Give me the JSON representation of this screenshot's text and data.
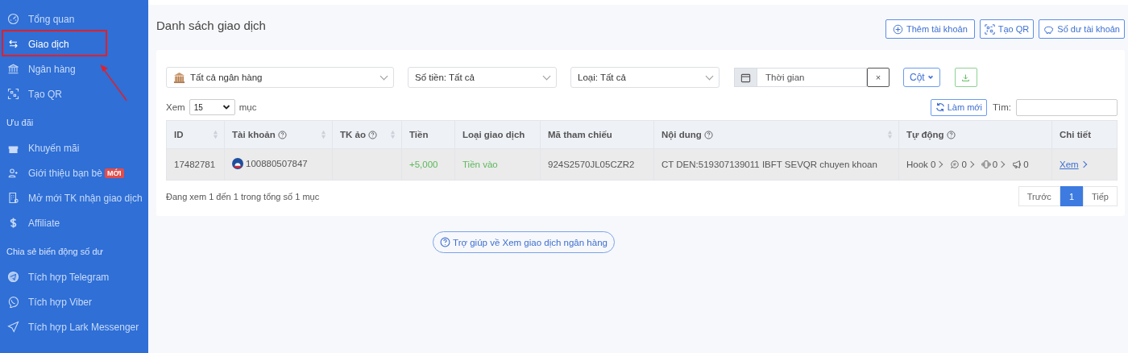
{
  "sidebar": {
    "groups": [
      {
        "items": [
          {
            "label": "Tổng quan",
            "selected": false
          },
          {
            "label": "Giao dịch",
            "selected": true
          },
          {
            "label": "Ngân hàng",
            "selected": false
          },
          {
            "label": "Tạo QR",
            "selected": false
          }
        ]
      },
      {
        "heading": "Ưu đãi",
        "items": [
          {
            "label": "Khuyến mãi",
            "selected": false
          },
          {
            "label": "Giới thiệu bạn bè",
            "badge": "MỚI",
            "selected": false
          },
          {
            "label": "Mở mới TK nhận giao dịch",
            "selected": false
          },
          {
            "label": "Affiliate",
            "selected": false
          }
        ]
      },
      {
        "heading": "Chia sẻ biến động số dư",
        "items": [
          {
            "label": "Tích hợp Telegram",
            "selected": false
          },
          {
            "label": "Tích hợp Viber",
            "selected": false
          },
          {
            "label": "Tích hợp Lark Messenger",
            "selected": false
          }
        ]
      }
    ]
  },
  "page": {
    "title": "Danh sách giao dịch",
    "actions": [
      "Thêm tài khoản",
      "Tạo QR",
      "Số dư tài khoản"
    ]
  },
  "filters": {
    "bank": "Tất cả ngân hàng",
    "amount": "Số tiền: Tất cả",
    "type": "Loại: Tất cả",
    "date_placeholder": "Thời gian",
    "clear": "×",
    "columns_button": "Cột"
  },
  "length": {
    "before": "Xem",
    "value": "15",
    "after": "mục"
  },
  "refresh": "Làm mới",
  "search_label": "Tìm:",
  "table": {
    "columns": [
      {
        "label": "ID",
        "help": false,
        "sortable": true
      },
      {
        "label": "Tài khoản",
        "help": true,
        "sortable": true
      },
      {
        "label": "TK ảo",
        "help": true,
        "sortable": true
      },
      {
        "label": "Tiền",
        "help": false,
        "sortable": false
      },
      {
        "label": "Loại giao dịch",
        "help": false,
        "sortable": false
      },
      {
        "label": "Mã tham chiếu",
        "help": false,
        "sortable": false
      },
      {
        "label": "Nội dung",
        "help": true,
        "sortable": true
      },
      {
        "label": "Tự động",
        "help": true,
        "sortable": false
      },
      {
        "label": "Chi tiết",
        "help": false,
        "sortable": false
      }
    ],
    "rows": [
      {
        "id": "17482781",
        "account": "100880507847",
        "amount": "+5,000",
        "type": "Tiền vào",
        "color": "#5cb85c",
        "reference": "924S2570JL05CZR2",
        "content": "CT DEN:519307139011 IBFT SEVQR chuyen khoan",
        "hook": "Hook 0",
        "chat": "0",
        "phone": "0",
        "broadcast": "0",
        "detail": "Xem"
      }
    ]
  },
  "info": "Đang xem 1 đến 1 trong tổng số 1 mục",
  "pagination": {
    "prev": "Trước",
    "pages": [
      {
        "label": "1",
        "selected": true
      }
    ],
    "next": "Tiếp"
  },
  "help": "Trợ giúp về Xem giao dịch ngân hàng"
}
